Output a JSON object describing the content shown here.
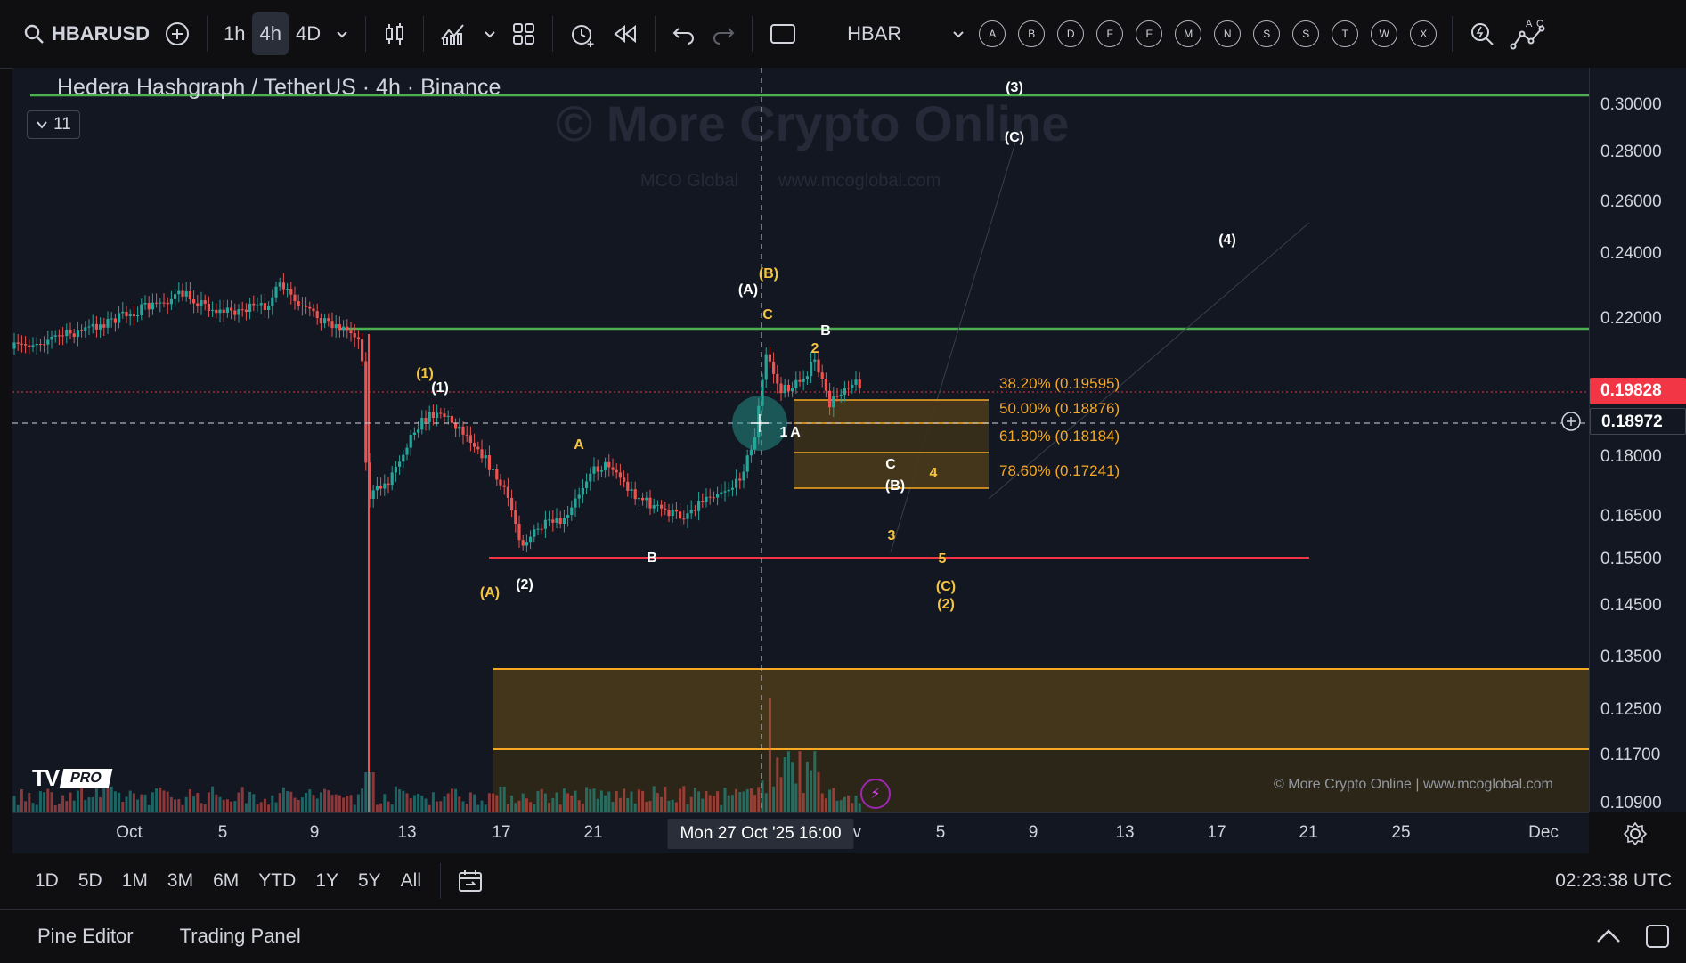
{
  "toolbar": {
    "symbol": "HBARUSD",
    "timeframes": [
      "1h",
      "4h",
      "4D"
    ],
    "active_timeframe": "4h",
    "layout_symbol": "HBAR",
    "circle_letters": [
      "A",
      "B",
      "D",
      "F",
      "F",
      "M",
      "N",
      "S",
      "S",
      "T",
      "W",
      "X"
    ]
  },
  "chart": {
    "title": "Hedera Hashgraph / TetherUS · 4h · Binance",
    "collapse_count": "11",
    "watermark": "© More Crypto Online",
    "watermark_sub1": "MCO Global",
    "watermark_sub2": "www.mcoglobal.com",
    "copyright": "© More Crypto Online  |  www.mcoglobal.com",
    "logo_pro": "PRO",
    "logo_tv": "TV"
  },
  "price_axis": {
    "labels": [
      "0.30000",
      "0.28000",
      "0.26000",
      "0.24000",
      "0.22000",
      "0.18000",
      "0.16500",
      "0.15500",
      "0.14500",
      "0.13500",
      "0.12500",
      "0.11700",
      "0.10900"
    ],
    "last_price": "0.19828",
    "crosshair_price": "0.18972"
  },
  "time_axis": {
    "labels": [
      "Oct",
      "5",
      "9",
      "13",
      "17",
      "21",
      "ov",
      "5",
      "9",
      "13",
      "17",
      "21",
      "25",
      "Dec"
    ],
    "crosshair_label": "Mon 27 Oct '25   16:00"
  },
  "fib_levels": [
    {
      "label": "38.20% (0.19595)"
    },
    {
      "label": "50.00% (0.18876)"
    },
    {
      "label": "61.80% (0.18184)"
    },
    {
      "label": "78.60% (0.17241)"
    }
  ],
  "wave_labels": [
    "(3)",
    "(C)",
    "(4)",
    "(A)",
    "(B)",
    "C",
    "B",
    "2",
    "(1)",
    "(1)",
    "1",
    "A",
    "A",
    "C",
    "4",
    "(B)",
    "3",
    "B",
    "5",
    "(A)",
    "(2)",
    "(C)",
    "(2)"
  ],
  "range_bar": {
    "ranges": [
      "1D",
      "5D",
      "1M",
      "3M",
      "6M",
      "YTD",
      "1Y",
      "5Y",
      "All"
    ],
    "clock": "02:23:38 UTC"
  },
  "bottom_bar": {
    "pine_editor": "Pine Editor",
    "trading_panel": "Trading Panel"
  },
  "colors": {
    "up": "#26a69a",
    "down": "#ef5350",
    "fib": "#f7a823",
    "green_line": "#4caf50",
    "red_line": "#f23645",
    "label_yellow": "#f5c542"
  }
}
